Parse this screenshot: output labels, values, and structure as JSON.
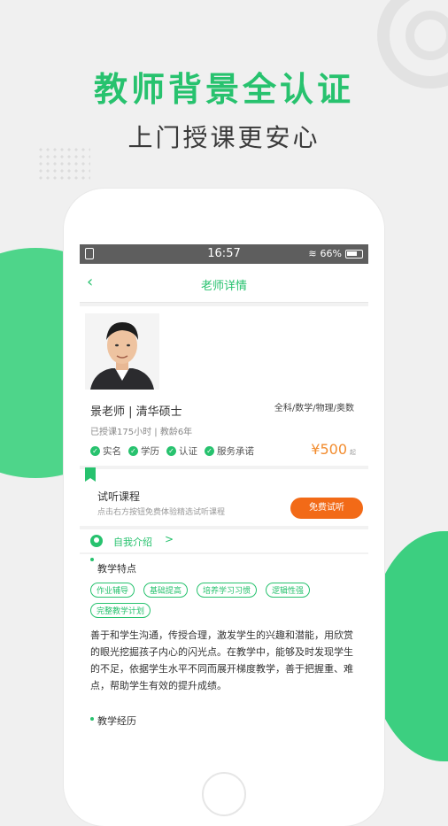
{
  "promo": {
    "headline": "教师背景全认证",
    "subline": "上门授课更安心"
  },
  "status_bar": {
    "time": "16:57",
    "battery": "66%"
  },
  "nav": {
    "back_icon": "chevron-left-icon",
    "title": "老师详情"
  },
  "profile": {
    "name": "景老师 | 清华硕士",
    "subjects": "全科/数学/物理/奥数",
    "hours": "已授课175小时 | 教龄6年",
    "badges": [
      "实名",
      "学历",
      "认证",
      "服务承诺"
    ],
    "price": "¥500",
    "price_unit": "起"
  },
  "trial": {
    "title": "试听课程",
    "subtitle": "点击右方按钮免费体验精选试听课程",
    "button": "免费试听"
  },
  "intro": {
    "label": "自我介绍",
    "chevron": ">"
  },
  "features": {
    "title": "教学特点",
    "tags": [
      "作业辅导",
      "基础提高",
      "培养学习习惯",
      "逻辑性强",
      "完整教学计划"
    ],
    "description": "善于和学生沟通，传授合理，激发学生的兴趣和潜能，用欣赏的眼光挖掘孩子内心的闪光点。在教学中，能够及时发现学生的不足，依据学生水平不同而展开梯度教学，善于把握重、难点，帮助学生有效的提升成绩。"
  },
  "experience": {
    "title": "教学经历"
  },
  "colors": {
    "brand_green": "#27c26e",
    "accent_orange": "#f26a17"
  }
}
